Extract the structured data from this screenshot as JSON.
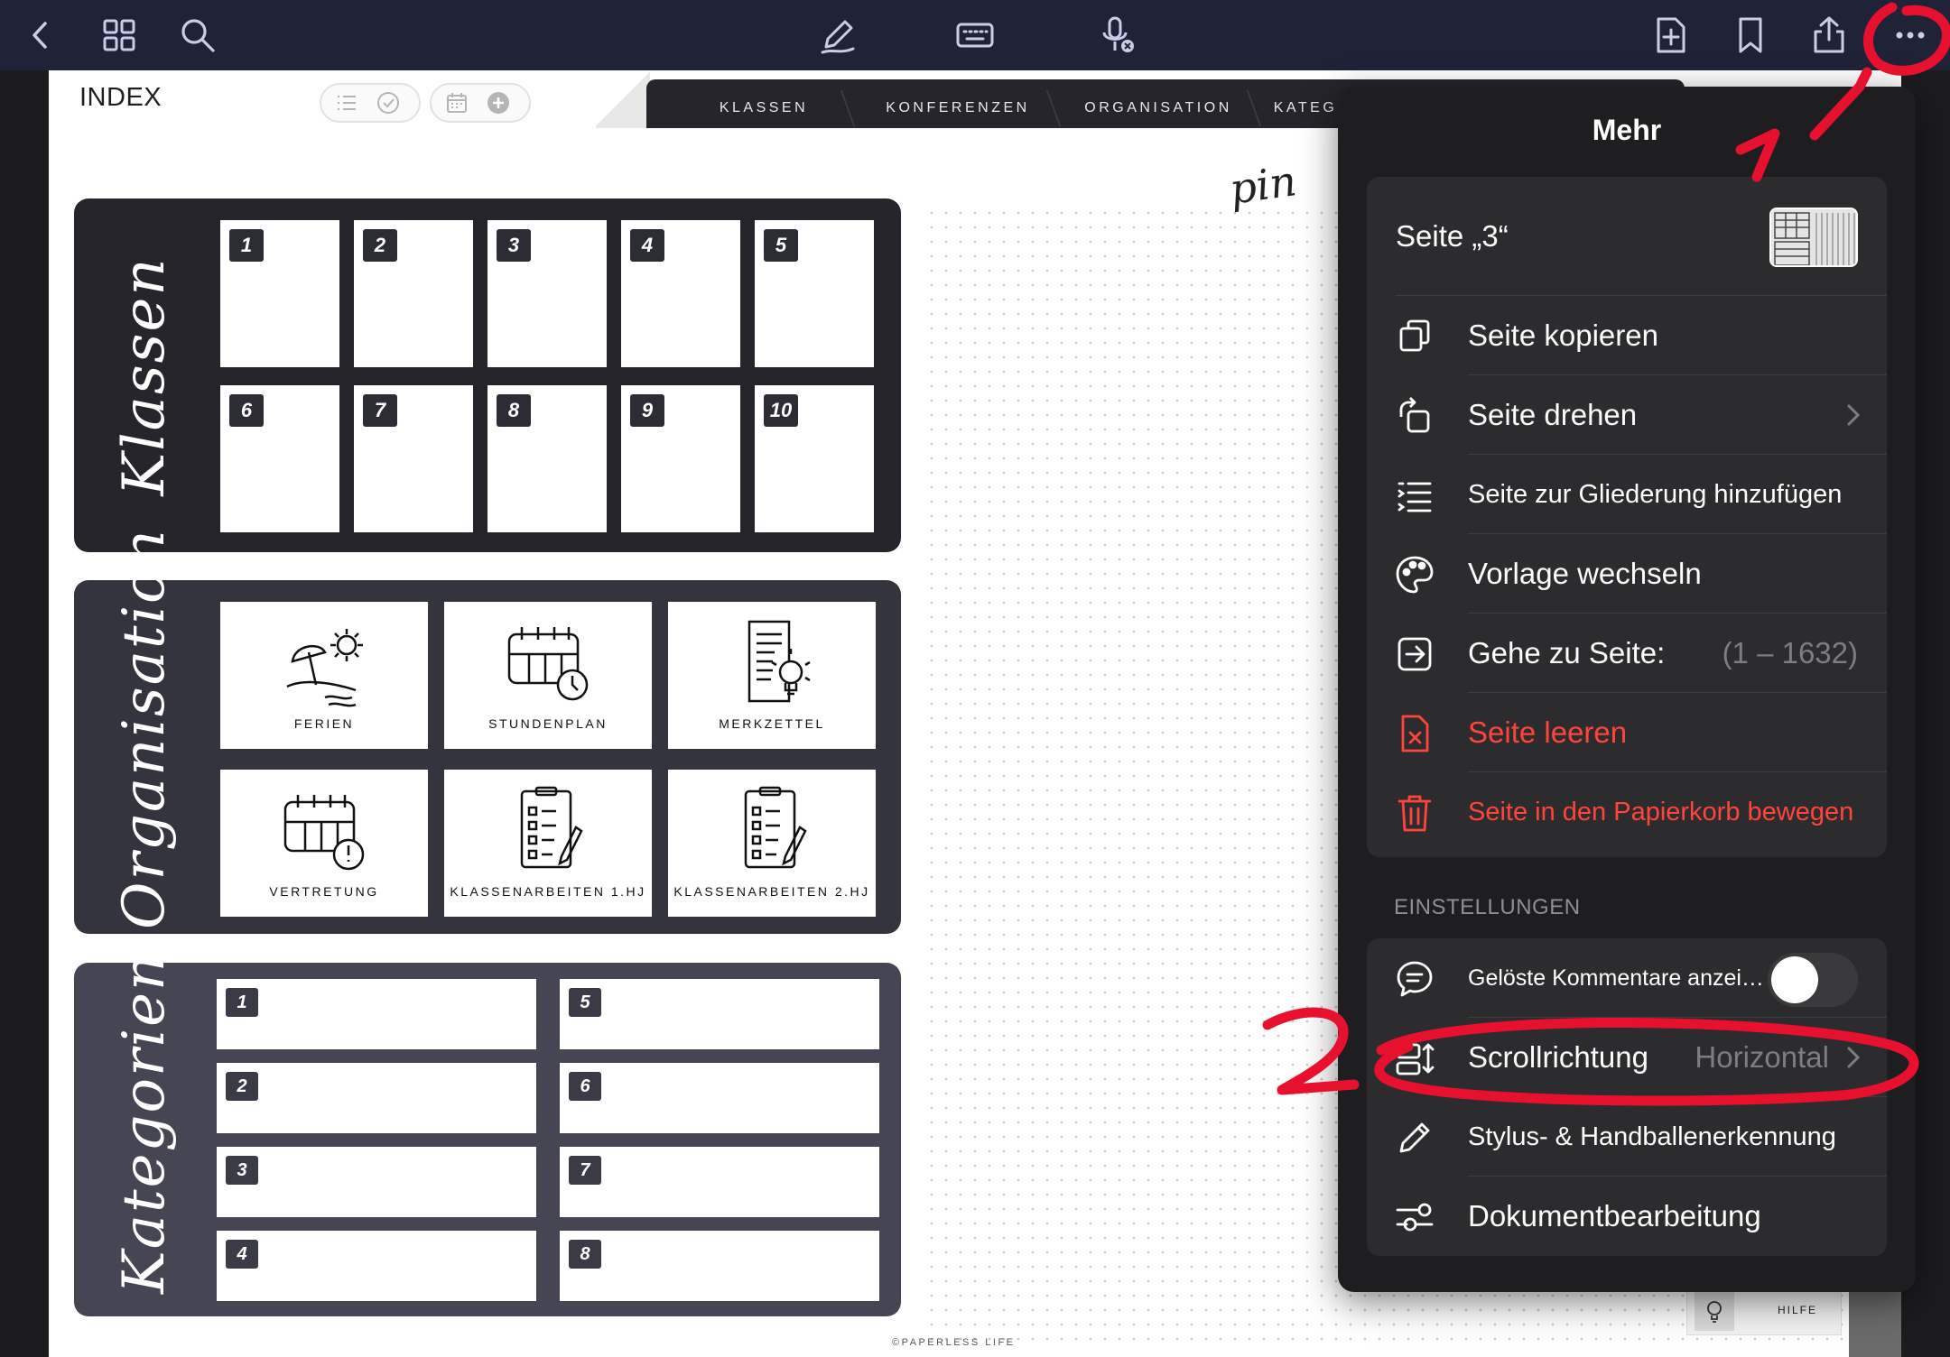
{
  "toolbar": {
    "left": [
      "back-icon",
      "grid-icon",
      "search-icon"
    ],
    "center": [
      "pen-icon",
      "keyboard-icon",
      "microphone-off-icon"
    ],
    "right": [
      "add-page-icon",
      "bookmark-icon",
      "share-icon",
      "more-icon"
    ]
  },
  "page": {
    "index_title": "INDEX",
    "tabs": [
      "KLASSEN",
      "KONFERENZEN",
      "ORGANISATION",
      "KATEG"
    ],
    "script_text": "pin",
    "klassen": {
      "label": "Klassen",
      "numbers": [
        "1",
        "2",
        "3",
        "4",
        "5",
        "6",
        "7",
        "8",
        "9",
        "10"
      ]
    },
    "organisation": {
      "label": "Organisation",
      "items": [
        "FERIEN",
        "STUNDENPLAN",
        "MERKZETTEL",
        "VERTRETUNG",
        "KLASSENARBEITEN 1.HJ",
        "KLASSENARBEITEN 2.HJ"
      ]
    },
    "kategorien": {
      "label": "Kategorien",
      "left": [
        "1",
        "2",
        "3",
        "4"
      ],
      "right": [
        "5",
        "6",
        "7",
        "8"
      ]
    },
    "footer_copyright": "©PAPERLESS LIFE",
    "help_label": "HILFE"
  },
  "popover": {
    "title": "Mehr",
    "page_row": "Seite „3“",
    "actions": [
      {
        "label": "Seite kopieren",
        "icon": "copy-icon"
      },
      {
        "label": "Seite drehen",
        "icon": "rotate-icon"
      },
      {
        "label": "Seite zur Gliederung hinzufügen",
        "icon": "outline-icon"
      },
      {
        "label": "Vorlage wechseln",
        "icon": "palette-icon"
      },
      {
        "label": "Gehe zu Seite:",
        "icon": "goto-icon",
        "value": "(1 – 1632)"
      },
      {
        "label": "Seite leeren",
        "icon": "clear-page-icon"
      },
      {
        "label": "Seite in den Papierkorb bewegen",
        "icon": "trash-icon"
      }
    ],
    "settings_header": "EINSTELLUNGEN",
    "settings": [
      {
        "label": "Gelöste Kommentare anzei…",
        "icon": "comment-icon",
        "toggle": false
      },
      {
        "label": "Scrollrichtung",
        "icon": "scroll-direction-icon",
        "value": "Horizontal"
      },
      {
        "label": "Stylus- & Handballenerkennung",
        "icon": "pencil-icon"
      },
      {
        "label": "Dokumentbearbeitung",
        "icon": "sliders-icon"
      }
    ],
    "destructive_color": "#ff453a"
  },
  "annotations": {
    "marker_1": "1",
    "marker_2": "2",
    "color": "#e8112d"
  },
  "colors": {
    "toolbar_bg": "#202338",
    "block_dark": "#25252b",
    "block_mid": "#34343f",
    "block_light": "#454554",
    "popover_bg": "#1e1e20",
    "group_bg": "#2c2c2e"
  }
}
